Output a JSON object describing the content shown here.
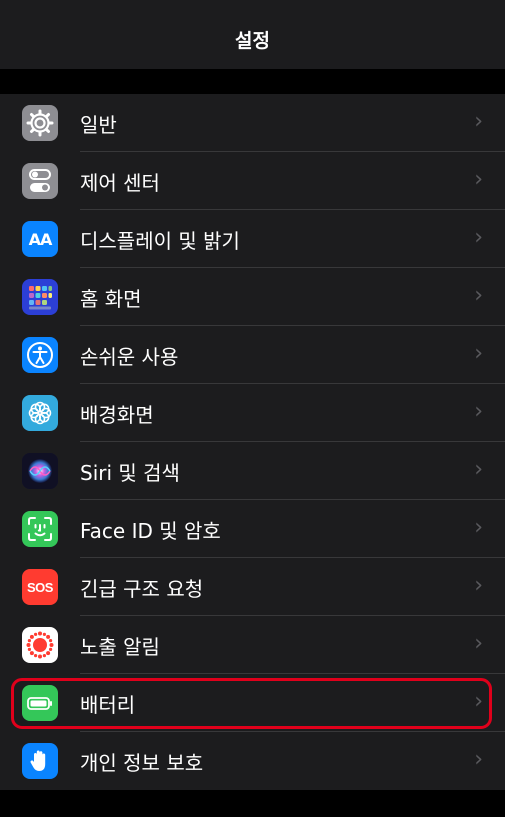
{
  "nav": {
    "title": "설정"
  },
  "items": [
    {
      "label": "일반",
      "icon": "gear-icon",
      "color": "#8e8e93"
    },
    {
      "label": "제어 센터",
      "icon": "toggle-switches-icon",
      "color": "#8e8e93"
    },
    {
      "label": "디스플레이 및 밝기",
      "icon": "text-size-icon",
      "icon_text": "AA",
      "color": "#0a84ff"
    },
    {
      "label": "홈 화면",
      "icon": "app-grid-icon",
      "color": "#2c3fd6"
    },
    {
      "label": "손쉬운 사용",
      "icon": "accessibility-icon",
      "color": "#0a84ff"
    },
    {
      "label": "배경화면",
      "icon": "flower-icon",
      "color": "#33aadd"
    },
    {
      "label": "Siri 및 검색",
      "icon": "siri-icon",
      "color": "#1c1c3a"
    },
    {
      "label": "Face ID 및 암호",
      "icon": "face-id-icon",
      "color": "#34c759"
    },
    {
      "label": "긴급 구조 요청",
      "icon": "sos-icon",
      "icon_text": "SOS",
      "color": "#ff3b30"
    },
    {
      "label": "노출 알림",
      "icon": "exposure-notification-icon",
      "color": "#ffffff"
    },
    {
      "label": "배터리",
      "icon": "battery-icon",
      "color": "#34c759"
    },
    {
      "label": "개인 정보 보호",
      "icon": "hand-icon",
      "color": "#0a84ff"
    }
  ],
  "highlight_color": "#e0001b"
}
